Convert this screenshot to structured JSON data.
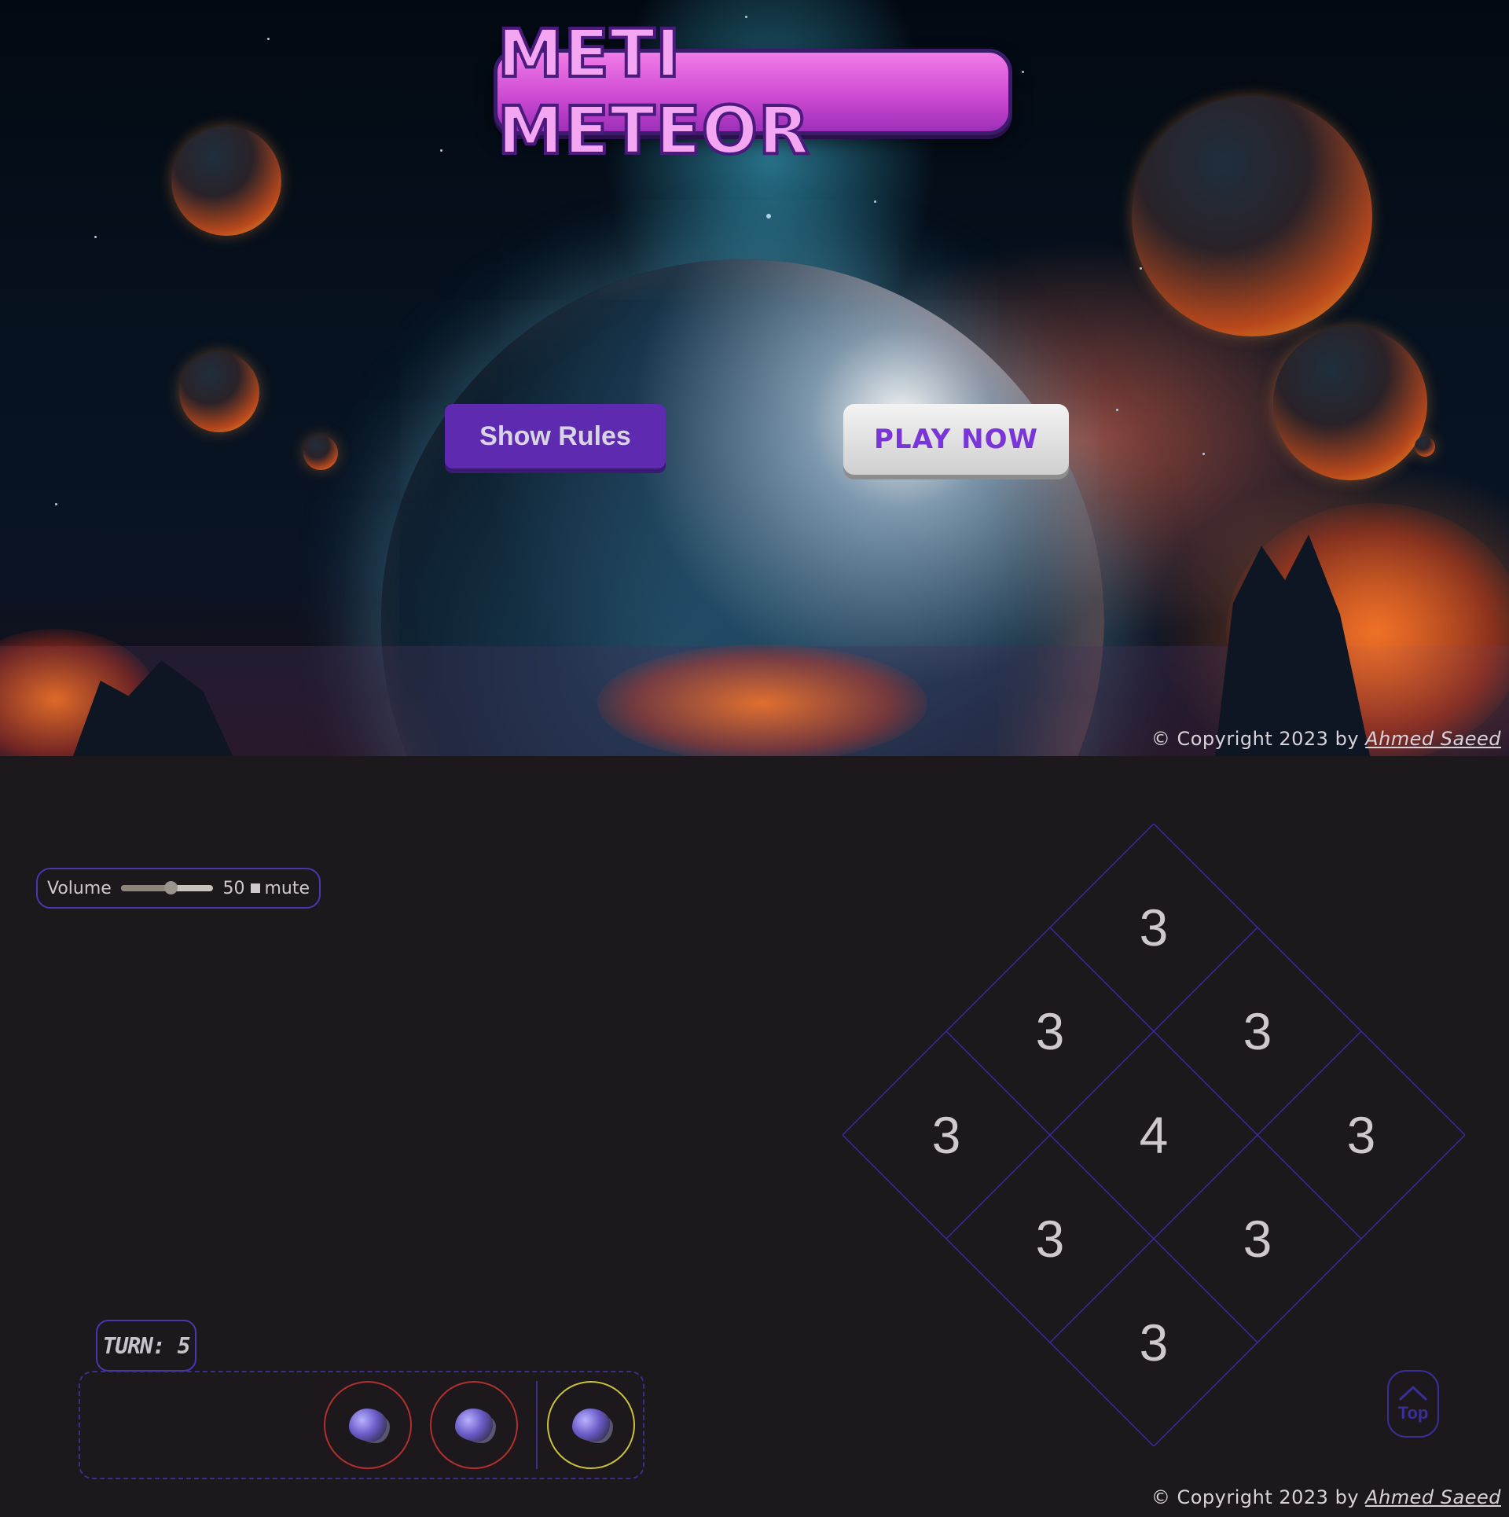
{
  "hero": {
    "logo_text": "METI METEOR",
    "show_rules_label": "Show Rules",
    "play_now_label": "PLAY NOW"
  },
  "copyright": {
    "prefix": "© Copyright 2023 by",
    "author": "Ahmed Saeed"
  },
  "volume": {
    "label": "Volume",
    "value": "50",
    "level": 0.5,
    "mute_label": "mute"
  },
  "board": {
    "cells": [
      {
        "value": "3"
      },
      {
        "value": "3"
      },
      {
        "value": "3"
      },
      {
        "value": "3"
      },
      {
        "value": "4"
      },
      {
        "value": "3"
      },
      {
        "value": "3"
      },
      {
        "value": "3"
      },
      {
        "value": "3"
      }
    ],
    "line_color": "#3b2aa0"
  },
  "turn": {
    "label": "TURN: 5"
  },
  "tokens": [
    {
      "name": "meteor-token-red-1",
      "ring": "red"
    },
    {
      "name": "meteor-token-red-2",
      "ring": "red"
    },
    {
      "name": "meteor-token-yellow",
      "ring": "yellow"
    }
  ],
  "top_button": {
    "label": "Top",
    "icon": "chevron-up-icon"
  }
}
